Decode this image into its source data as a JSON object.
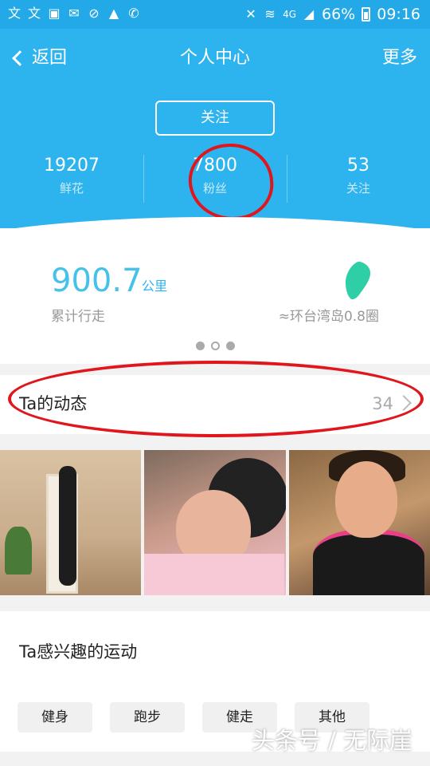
{
  "status_bar": {
    "left_icons": [
      "app-notification-icon",
      "app-notification-icon",
      "image-icon",
      "mail-icon",
      "blocked-icon",
      "warning-icon",
      "missed-call-icon"
    ],
    "right_icons": [
      "mute-icon",
      "wifi-icon",
      "network-4g-icon",
      "signal-icon",
      "battery-icon"
    ],
    "network": "4G",
    "battery": "66%",
    "time": "09:16"
  },
  "header": {
    "back_label": "返回",
    "title": "个人中心",
    "more_label": "更多",
    "follow_button": "关注",
    "accent_color": "#2db3ee"
  },
  "stats": [
    {
      "value": "19207",
      "label": "鲜花"
    },
    {
      "value": "7800",
      "label": "粉丝"
    },
    {
      "value": "53",
      "label": "关注"
    }
  ],
  "distance": {
    "value": "900.7",
    "unit": "公里",
    "label": "累计行走",
    "comparison": "≈环台湾岛0.8圈",
    "carousel_pages": 3,
    "carousel_current": 1
  },
  "activity": {
    "title": "Ta的动态",
    "count": "34"
  },
  "photos": [
    "photo-stretching",
    "photo-selfie-lying",
    "photo-selfie-gym"
  ],
  "sports": {
    "title": "Ta感兴趣的运动",
    "tags": [
      "健身",
      "跑步",
      "健走",
      "其他"
    ]
  },
  "watermark": "头条号 / 无际崖",
  "annotation_color": "#e0161c"
}
